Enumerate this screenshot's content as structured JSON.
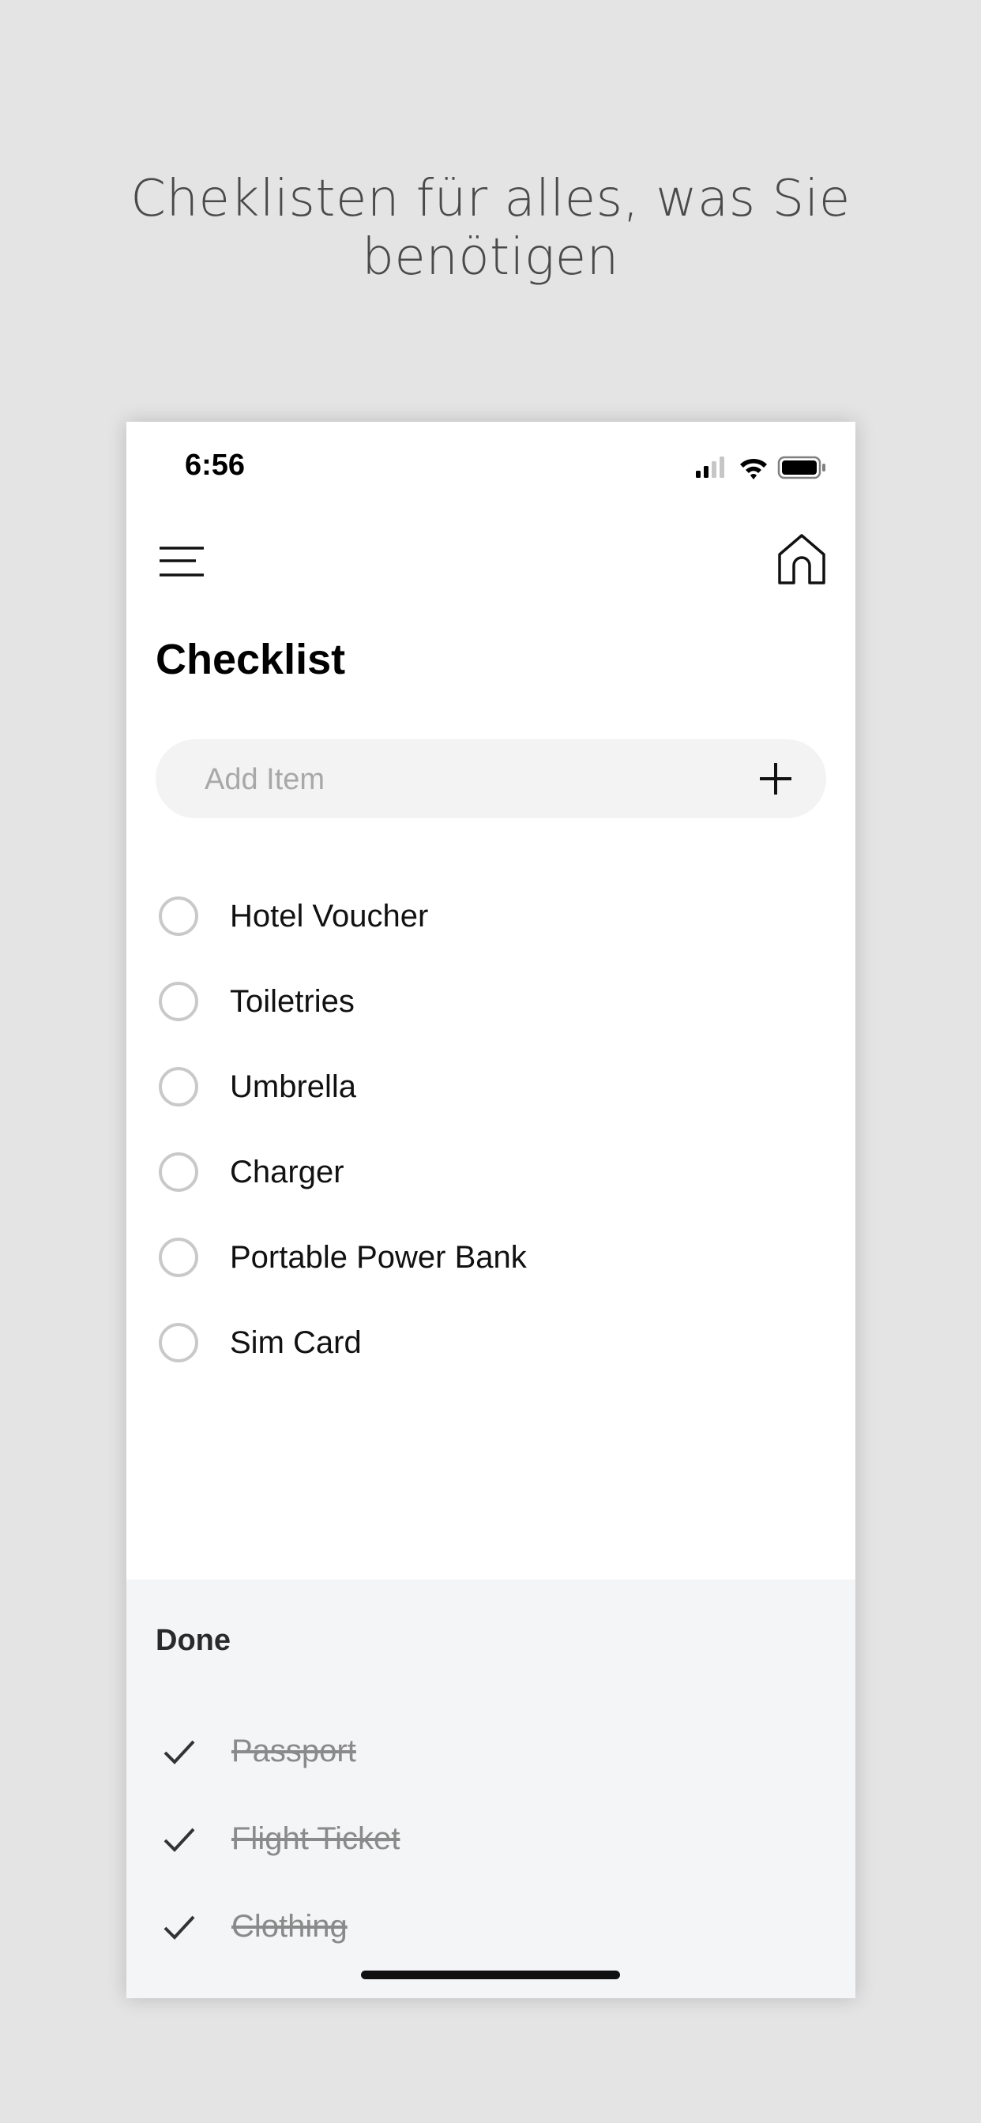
{
  "headline": "Cheklisten für alles, was Sie benötigen",
  "status_bar": {
    "time": "6:56",
    "icons": [
      "signal-icon",
      "wifi-icon",
      "battery-icon"
    ]
  },
  "toolbar": {
    "left_icon": "menu-icon",
    "right_icon": "home-icon"
  },
  "page_title": "Checklist",
  "add_item": {
    "placeholder": "Add Item",
    "button_icon": "plus-icon"
  },
  "todo_items": [
    {
      "label": "Hotel Voucher"
    },
    {
      "label": "Toiletries"
    },
    {
      "label": "Umbrella"
    },
    {
      "label": "Charger"
    },
    {
      "label": "Portable Power Bank"
    },
    {
      "label": "Sim Card"
    }
  ],
  "done": {
    "title": "Done",
    "items": [
      {
        "label": "Passport"
      },
      {
        "label": "Flight Ticket"
      },
      {
        "label": "Clothing"
      }
    ]
  },
  "colors": {
    "background": "#e4e4e4",
    "done_background": "#f4f5f7",
    "circle_border": "#c9c9c9",
    "done_text": "#8a8a8a"
  }
}
